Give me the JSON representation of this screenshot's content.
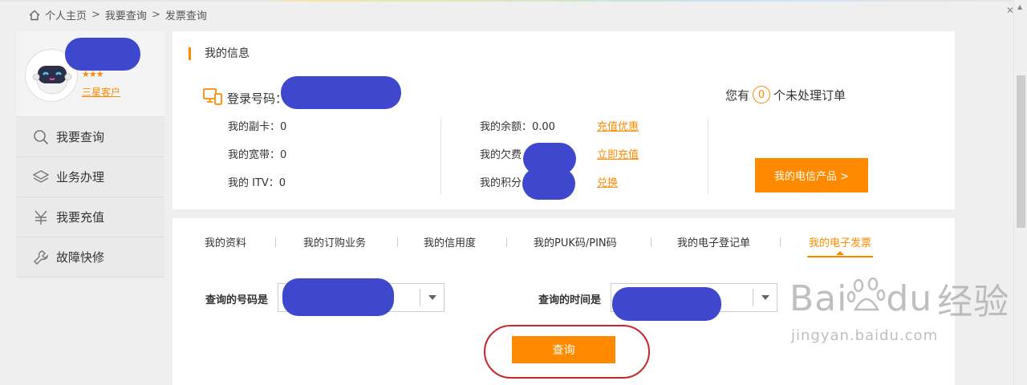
{
  "breadcrumb": {
    "home": "个人主页",
    "sep1": ">",
    "query": "我要查询",
    "sep2": ">",
    "current": "发票查询"
  },
  "profile": {
    "stars": "★★★",
    "level": "三星客户"
  },
  "sidebar": {
    "items": [
      {
        "label": "我要查询",
        "icon": "search-icon"
      },
      {
        "label": "业务办理",
        "icon": "layers-icon"
      },
      {
        "label": "我要充值",
        "icon": "yuan-icon"
      },
      {
        "label": "故障快修",
        "icon": "wrench-icon"
      }
    ]
  },
  "info": {
    "title": "我的信息",
    "login_label": "登录号码：",
    "left_col": {
      "sub_card": "我的副卡：0",
      "broadband": "我的宽带：0",
      "itv": "我的 ITV：0"
    },
    "mid_col": {
      "balance": "我的余额：0.00",
      "arrears": "我的欠费",
      "points": "我的积分"
    },
    "links": {
      "recharge_offer": "充值优惠",
      "recharge_now": "立即充值",
      "redeem": "兑换"
    },
    "pending": {
      "prefix": "您有",
      "count": "0",
      "suffix": "个未处理订单"
    },
    "products_button": "我的电信产品 >"
  },
  "tabs": [
    {
      "label": "我的资料"
    },
    {
      "label": "我的订购业务"
    },
    {
      "label": "我的信用度"
    },
    {
      "label": "我的PUK码/PIN码"
    },
    {
      "label": "我的电子登记单"
    },
    {
      "label": "我的电子发票"
    }
  ],
  "query": {
    "number_label": "查询的号码是",
    "time_label": "查询的时间是",
    "button": "查询"
  },
  "watermark": {
    "main": "Bai",
    "mid": "du",
    "cn": "经验",
    "sub": "jingyan.baidu.com"
  },
  "colors": {
    "accent": "#ff8a00",
    "redaction": "#3f48cc",
    "highlight_ring": "#c8262b"
  }
}
